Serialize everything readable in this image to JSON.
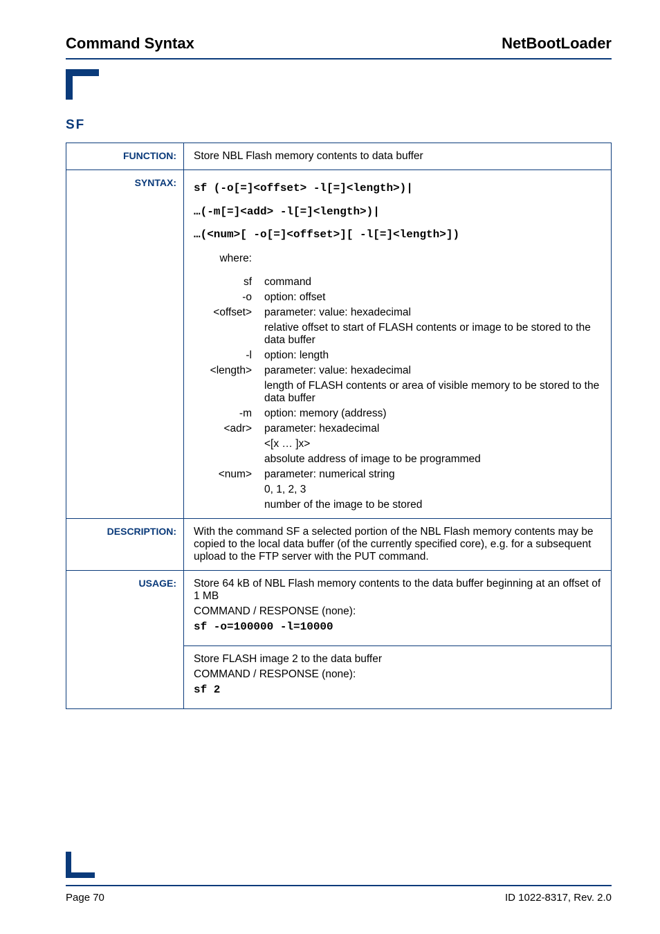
{
  "header": {
    "left": "Command Syntax",
    "right": "NetBootLoader"
  },
  "cmd_title": "SF",
  "labels": {
    "function": "FUNCTION:",
    "syntax": "SYNTAX:",
    "description": "DESCRIPTION:",
    "usage": "USAGE:"
  },
  "function_text": "Store NBL Flash memory contents to data buffer",
  "syntax_lines": [
    "sf (-o[=]<offset> -l[=]<length>)|",
    "…(-m[=]<add> -l[=]<length>)|",
    "…(<num>[ -o[=]<offset>][ -l[=]<length>])"
  ],
  "where_label": "where:",
  "where_rows": [
    {
      "k": "sf",
      "v": "command"
    },
    {
      "k": "-o",
      "v": "option: offset"
    },
    {
      "k": "<offset>",
      "v": "parameter: value: hexadecimal"
    },
    {
      "k": "",
      "v": "relative offset to start of FLASH contents or image to be stored to the data buffer"
    },
    {
      "k": "-l",
      "v": "option: length"
    },
    {
      "k": "<length>",
      "v": "parameter: value: hexadecimal"
    },
    {
      "k": "",
      "v": "length of FLASH contents or area of visible memory to be stored to the data buffer"
    },
    {
      "k": "-m",
      "v": "option: memory (address)"
    },
    {
      "k": "<adr>",
      "v": "parameter: hexadecimal"
    },
    {
      "k": "",
      "v": "<[x … ]x>"
    },
    {
      "k": "",
      "v": "absolute address of image to be programmed"
    },
    {
      "k": "<num>",
      "v": "parameter: numerical string"
    },
    {
      "k": "",
      "v": "0, 1, 2, 3"
    },
    {
      "k": "",
      "v": "number of the image to be stored"
    }
  ],
  "description_text": "With the command SF a selected portion of the NBL Flash memory contents may be copied to the local data buffer (of the currently specified core), e.g. for a subsequent upload to the FTP server with the PUT command.",
  "usage": {
    "block1_intro": "Store 64 kB of NBL Flash memory contents to the data buffer beginning at an offset of 1 MB",
    "block1_cmdresp": "COMMAND / RESPONSE (none):",
    "block1_cmd": "sf -o=100000 -l=10000",
    "block2_intro": "Store FLASH image 2 to the data buffer",
    "block2_cmdresp": "COMMAND / RESPONSE (none):",
    "block2_cmd": "sf 2"
  },
  "footer": {
    "left": "Page 70",
    "right": "ID 1022-8317, Rev. 2.0"
  }
}
